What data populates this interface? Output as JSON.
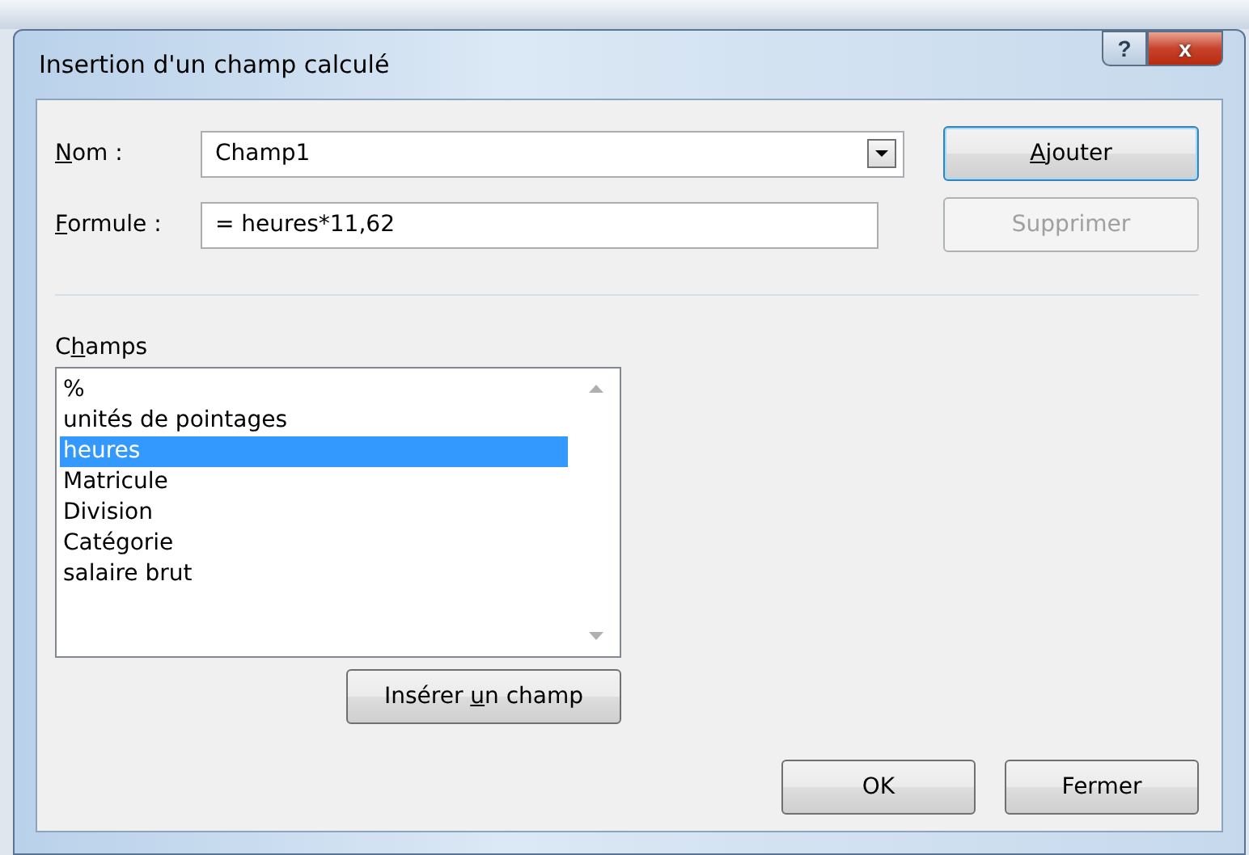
{
  "window": {
    "title": "Insertion d'un champ calculé",
    "help_button": "?",
    "close_button": "x"
  },
  "name_field": {
    "label": {
      "key": "N",
      "post": "om :"
    },
    "value": "Champ1"
  },
  "formula_field": {
    "label": {
      "key": "F",
      "post": "ormule :"
    },
    "value": "= heures*11,62"
  },
  "add_button": {
    "label": {
      "key": "A",
      "post": "jouter"
    },
    "disabled": false
  },
  "delete_button": {
    "label": {
      "post": "Supprimer"
    },
    "disabled": true
  },
  "fields_label": {
    "pre": "C",
    "key": "h",
    "post": "amps"
  },
  "fields": [
    {
      "label": "%",
      "selected": false
    },
    {
      "label": "unités de pointages",
      "selected": false
    },
    {
      "label": "heures",
      "selected": true
    },
    {
      "label": "Matricule",
      "selected": false
    },
    {
      "label": "Division",
      "selected": false
    },
    {
      "label": "Catégorie",
      "selected": false
    },
    {
      "label": "salaire brut",
      "selected": false
    }
  ],
  "insert_button": {
    "pre": "Insérer ",
    "key": "u",
    "post": "n champ"
  },
  "buttons": [
    "OK",
    "Fermer"
  ]
}
